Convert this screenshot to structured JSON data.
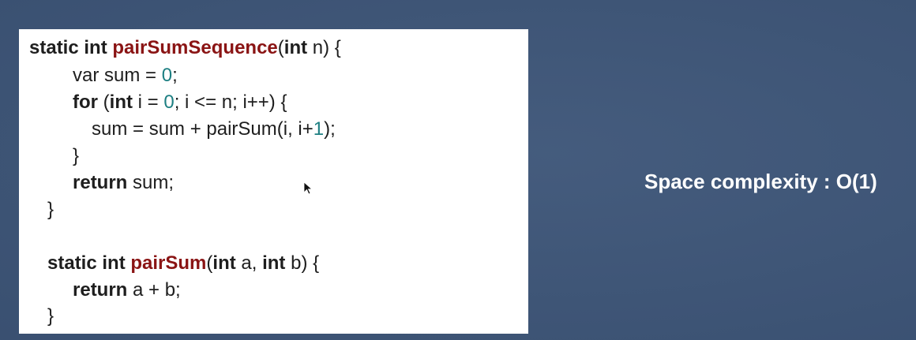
{
  "code": {
    "line1": {
      "kw_static": "static",
      "kw_int": "int",
      "fn_name": "pairSumSequence",
      "paren_open": "(",
      "kw_param_type": "int",
      "tail": " n) {"
    },
    "line2": {
      "text": "var sum = ",
      "num": "0",
      "end": ";"
    },
    "line3": {
      "kw_for": "for",
      "open": " (",
      "kw_int": "int",
      "mid": " i = ",
      "num": "0",
      "tail": "; i <= n; i++) {"
    },
    "line4": {
      "text": "sum = sum + pairSum(i, i+",
      "num": "1",
      "end": ");"
    },
    "line5": {
      "text": "}"
    },
    "line6": {
      "kw_return": "return",
      "tail": " sum;"
    },
    "line7": {
      "text": "}"
    },
    "line8": {
      "kw_static": "static",
      "kw_int": "int",
      "fn_name": "pairSum",
      "paren_open": "(",
      "kw_int_a": "int",
      "mid": " a, ",
      "kw_int_b": "int",
      "tail": " b) {"
    },
    "line9": {
      "kw_return": "return",
      "tail": " a + b;"
    },
    "line10": {
      "text": "}"
    }
  },
  "complexity_label": "Space complexity : O(1)",
  "colors": {
    "background": "#3d5578",
    "panel": "#ffffff",
    "keyword": "#1e1e1e",
    "function_name": "#8a1414",
    "number": "#1d7f82",
    "label": "#ffffff"
  },
  "icons": {
    "pointer": "mouse-pointer-icon"
  }
}
